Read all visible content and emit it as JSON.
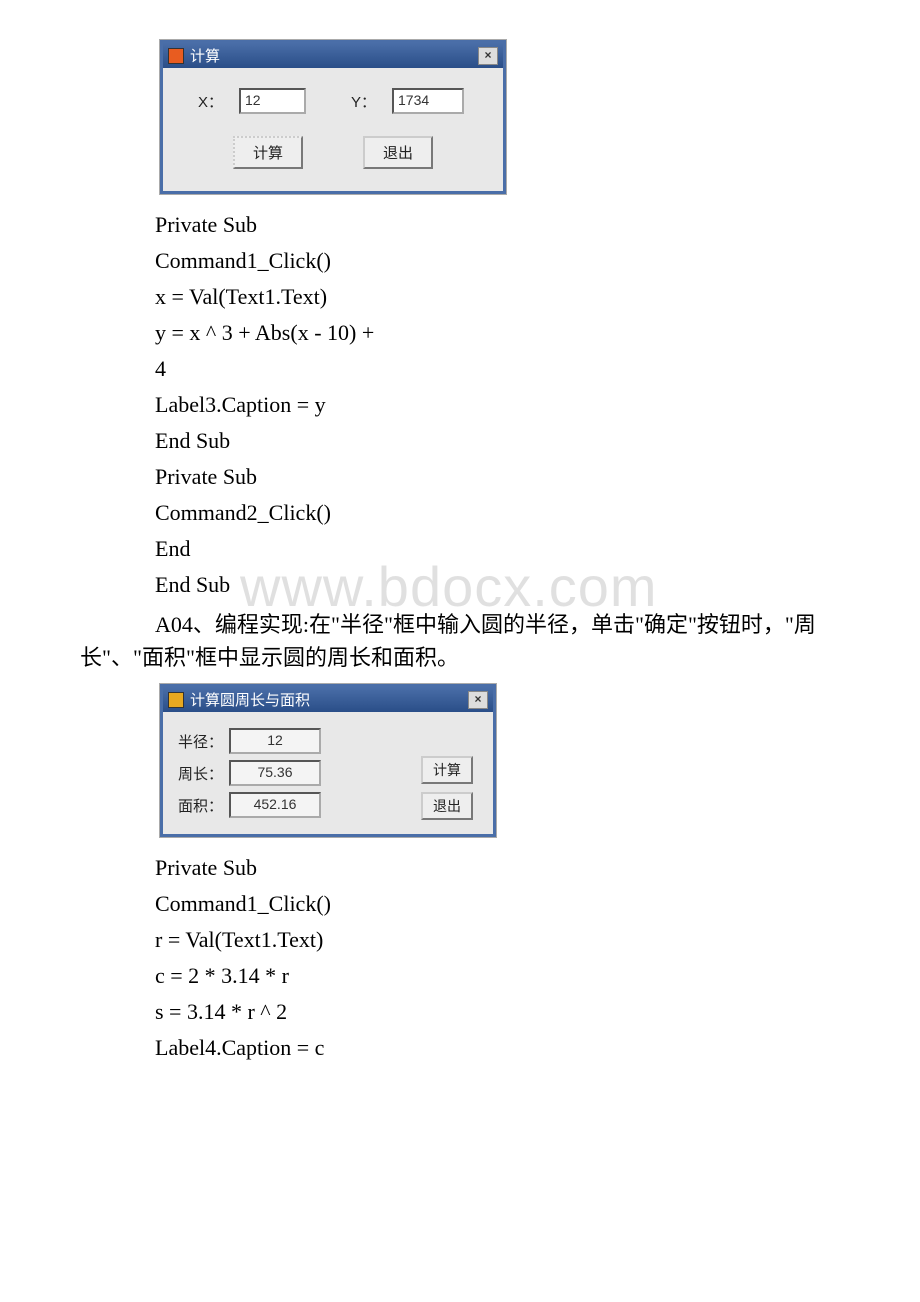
{
  "win1": {
    "title": "计算",
    "labels": {
      "x": "X：",
      "y": "Y："
    },
    "values": {
      "x": "12",
      "y": "1734"
    },
    "buttons": {
      "calc": "计算",
      "exit": "退出"
    }
  },
  "code1": {
    "lines": [
      "Private Sub",
      "Command1_Click()",
      "x = Val(Text1.Text)",
      "y = x ^ 3 + Abs(x - 10) +",
      "4",
      "Label3.Caption = y",
      "End Sub",
      "Private Sub",
      "Command2_Click()",
      "End",
      "End Sub"
    ]
  },
  "narrative1": "A04、编程实现:在\"半径\"框中输入圆的半径，单击\"确定\"按钮时，\"周长\"、\"面积\"框中显示圆的周长和面积。",
  "win2": {
    "title": "计算圆周长与面积",
    "labels": {
      "r": "半径：",
      "c": "周长：",
      "s": "面积："
    },
    "values": {
      "r": "12",
      "c": "75.36",
      "s": "452.16"
    },
    "buttons": {
      "calc": "计算",
      "exit": "退出"
    }
  },
  "code2": {
    "lines": [
      "Private Sub",
      "Command1_Click()",
      "r = Val(Text1.Text)",
      "c = 2 * 3.14 * r",
      "s = 3.14 * r ^ 2",
      "Label4.Caption = c"
    ]
  },
  "watermark": "www.bdocx.com"
}
